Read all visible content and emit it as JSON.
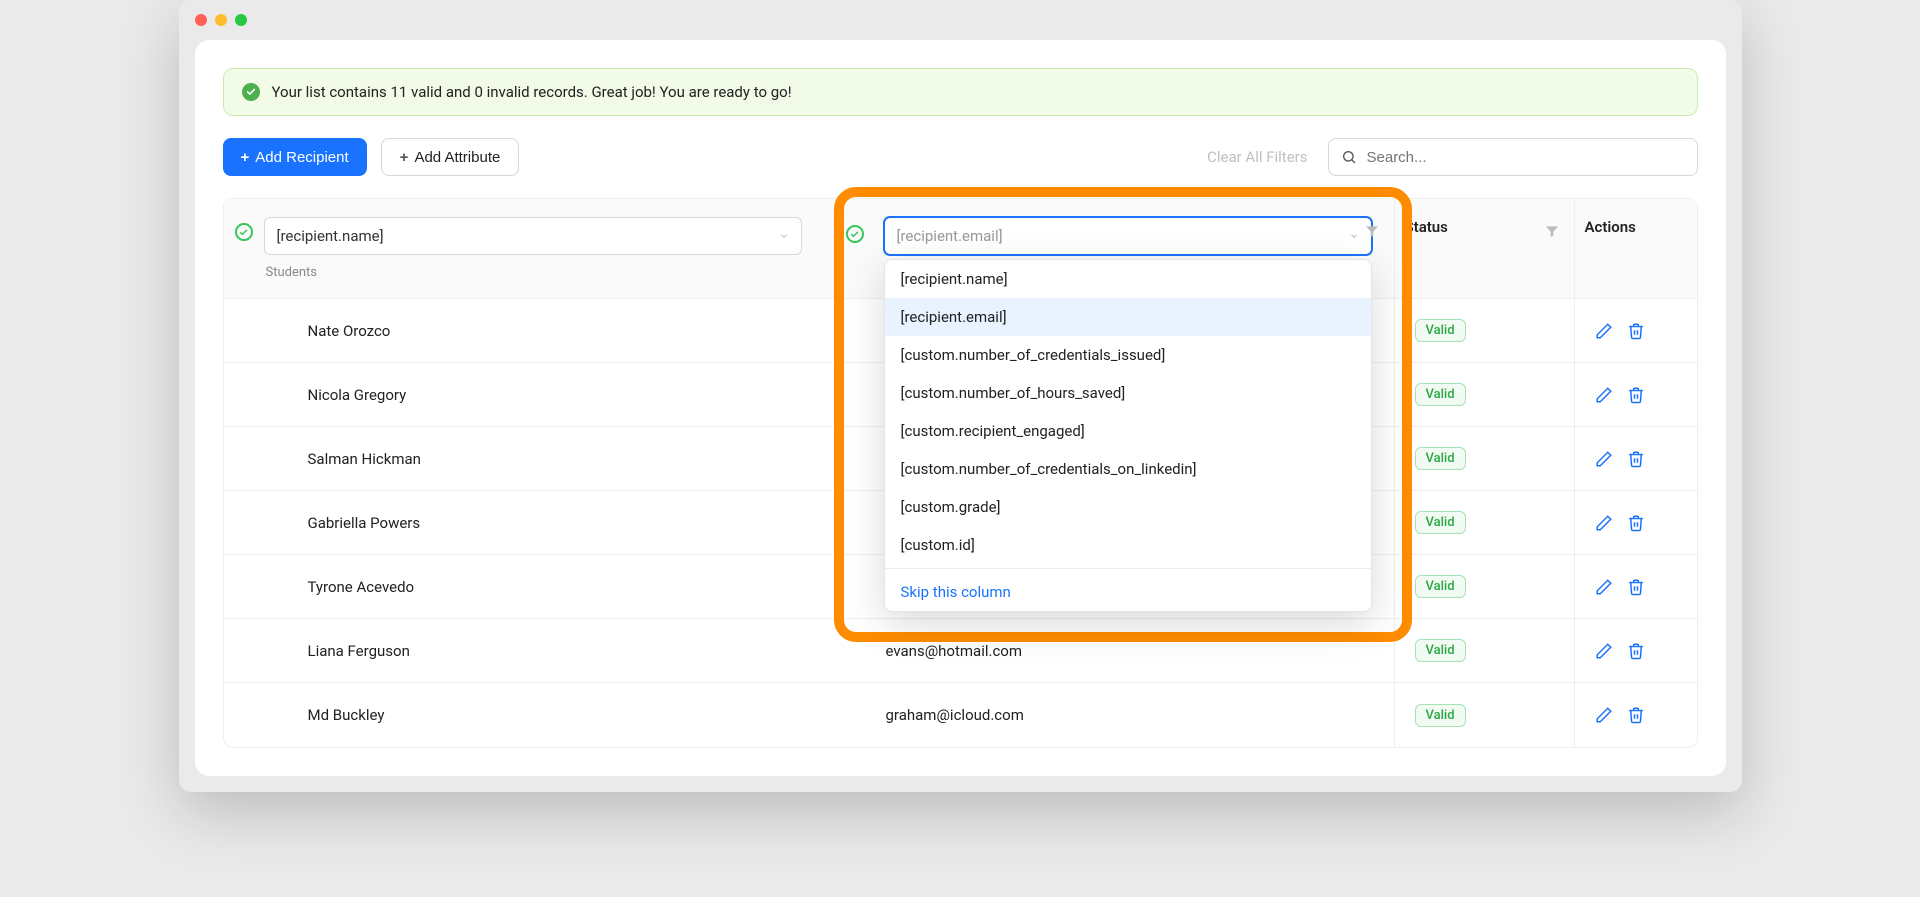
{
  "banner": {
    "text": "Your list contains 11 valid and 0 invalid records. Great job! You are ready to go!"
  },
  "toolbar": {
    "add_recipient_label": "Add Recipient",
    "add_attribute_label": "Add Attribute",
    "clear_filters_label": "Clear All Filters",
    "search_placeholder": "Search..."
  },
  "table": {
    "col_name": {
      "selected": "[recipient.name]",
      "subtitle": "Students"
    },
    "col_email": {
      "placeholder": "[recipient.email]"
    },
    "status_header": "Status",
    "actions_header": "Actions"
  },
  "dropdown_options": {
    "0": {
      "label": "[recipient.name]"
    },
    "1": {
      "label": "[recipient.email]"
    },
    "2": {
      "label": "[custom.number_of_credentials_issued]"
    },
    "3": {
      "label": "[custom.number_of_hours_saved]"
    },
    "4": {
      "label": "[custom.recipient_engaged]"
    },
    "5": {
      "label": "[custom.number_of_credentials_on_linkedin]"
    },
    "6": {
      "label": "[custom.grade]"
    },
    "7": {
      "label": "[custom.id]"
    },
    "skip": "Skip this column"
  },
  "rows": {
    "0": {
      "name": "Nate Orozco",
      "email": "",
      "status": "Valid"
    },
    "1": {
      "name": "Nicola Gregory",
      "email": "",
      "status": "Valid"
    },
    "2": {
      "name": "Salman Hickman",
      "email": "",
      "status": "Valid"
    },
    "3": {
      "name": "Gabriella Powers",
      "email": "",
      "status": "Valid"
    },
    "4": {
      "name": "Tyrone Acevedo",
      "email": "",
      "status": "Valid"
    },
    "5": {
      "name": "Liana Ferguson",
      "email": "evans@hotmail.com",
      "status": "Valid"
    },
    "6": {
      "name": "Md Buckley",
      "email": "graham@icloud.com",
      "status": "Valid"
    }
  },
  "colors": {
    "primary": "#1a73ff",
    "success": "#2aa745",
    "highlight": "#ff8c00"
  }
}
